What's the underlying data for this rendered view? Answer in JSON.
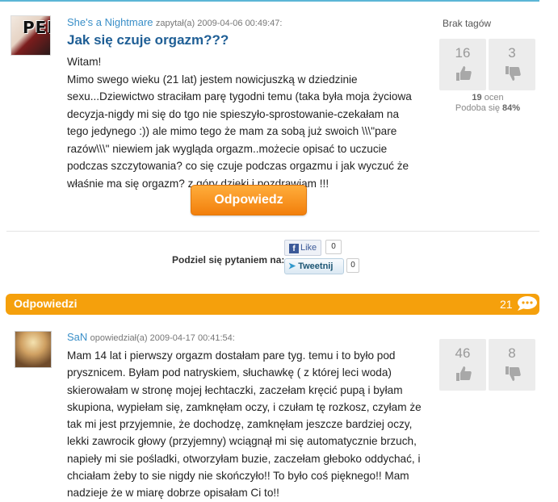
{
  "question": {
    "author": "She's a Nightmare",
    "meta_rest": "zapytał(a) 2009-04-06 00:49:47:",
    "title": "Jak się czuje orgazm???",
    "avatar_watermark": "PENERA.PL",
    "body_lines": [
      "Witam!",
      "Mimo swego wieku (21 lat) jestem nowicjuszką w dziedzinie sexu...Dziewictwo straciłam parę tygodni temu (taka była moja życiowa decyzja-nigdy mi się do tgo nie spieszyło-sprostowanie-czekałam na tego jedynego :)) ale mimo tego że mam za sobą już swoich \\\\\\\"pare razów\\\\\\\" niewiem jak wygląda orgazm..możecie opisać to uczucie podczas szczytowania? co się czuje podczas orgazmu i jak wyczuć że właśnie ma się orgazm? z góry dzięki i pozdrawiam !!!"
    ],
    "answer_button": "Odpowiedz",
    "tags": "Brak tagów",
    "votes_up": "16",
    "votes_down": "3",
    "ratings_count": "19",
    "ratings_label": "ocen",
    "likes_label": "Podoba się",
    "likes_percent": "84%"
  },
  "share": {
    "label": "Podziel się pytaniem na:",
    "fb_label": "Like",
    "fb_count": "0",
    "tweet_label": "Tweetnij",
    "tweet_count": "0"
  },
  "answers_bar": {
    "title": "Odpowiedzi",
    "count": "21"
  },
  "answer": {
    "author": "SaN",
    "meta_rest": "opowiedział(a) 2009-04-17 00:41:54:",
    "body": "Mam 14 lat i pierwszy orgazm dostałam pare tyg. temu i to było pod prysznicem. Byłam pod natryskiem, słuchawkę ( z której leci woda) skierowałam w stronę mojej łechtaczki, zaczełam kręcić pupą i byłam skupiona, wypiełam się, zamknęłam oczy, i czułam tę rozkosz, czyłam że tak mi jest przyjemnie, że dochodzę, zamknęłam jeszcze bardziej oczy, lekki zawrocik głowy (przyjemny) wciągnął mi się automatycznie brzuch, napieły mi sie pośladki, otworzyłam buzie, zaczełam głeboko oddychać, i chciałam żeby to sie nigdy nie skończyło!! To było coś pięknego!! Mam nadzieje że w miarę dobrze opisałam Ci to!!",
    "votes_up": "46",
    "votes_down": "8"
  },
  "colors": {
    "accent": "#f5a00c",
    "link": "#3a8fc8",
    "title": "#1e5e95"
  }
}
